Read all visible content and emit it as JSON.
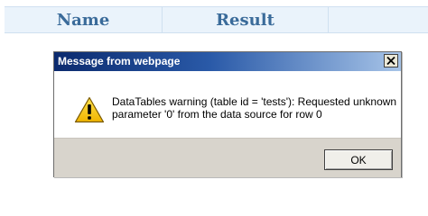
{
  "table": {
    "headers": [
      "Name",
      "Result",
      ""
    ]
  },
  "dialog": {
    "title": "Message from webpage",
    "close_icon": "close-icon",
    "warning_icon": "warning-icon",
    "message_line1": "DataTables warning (table id = 'tests'): Requested unknown",
    "message_line2": "parameter '0' from the data source for row 0",
    "ok_label": "OK"
  },
  "colors": {
    "header_text": "#3a6b9a",
    "title_gradient_start": "#0b2a6e",
    "title_gradient_end": "#a7c4e8",
    "warning_yellow": "#f5c400"
  }
}
